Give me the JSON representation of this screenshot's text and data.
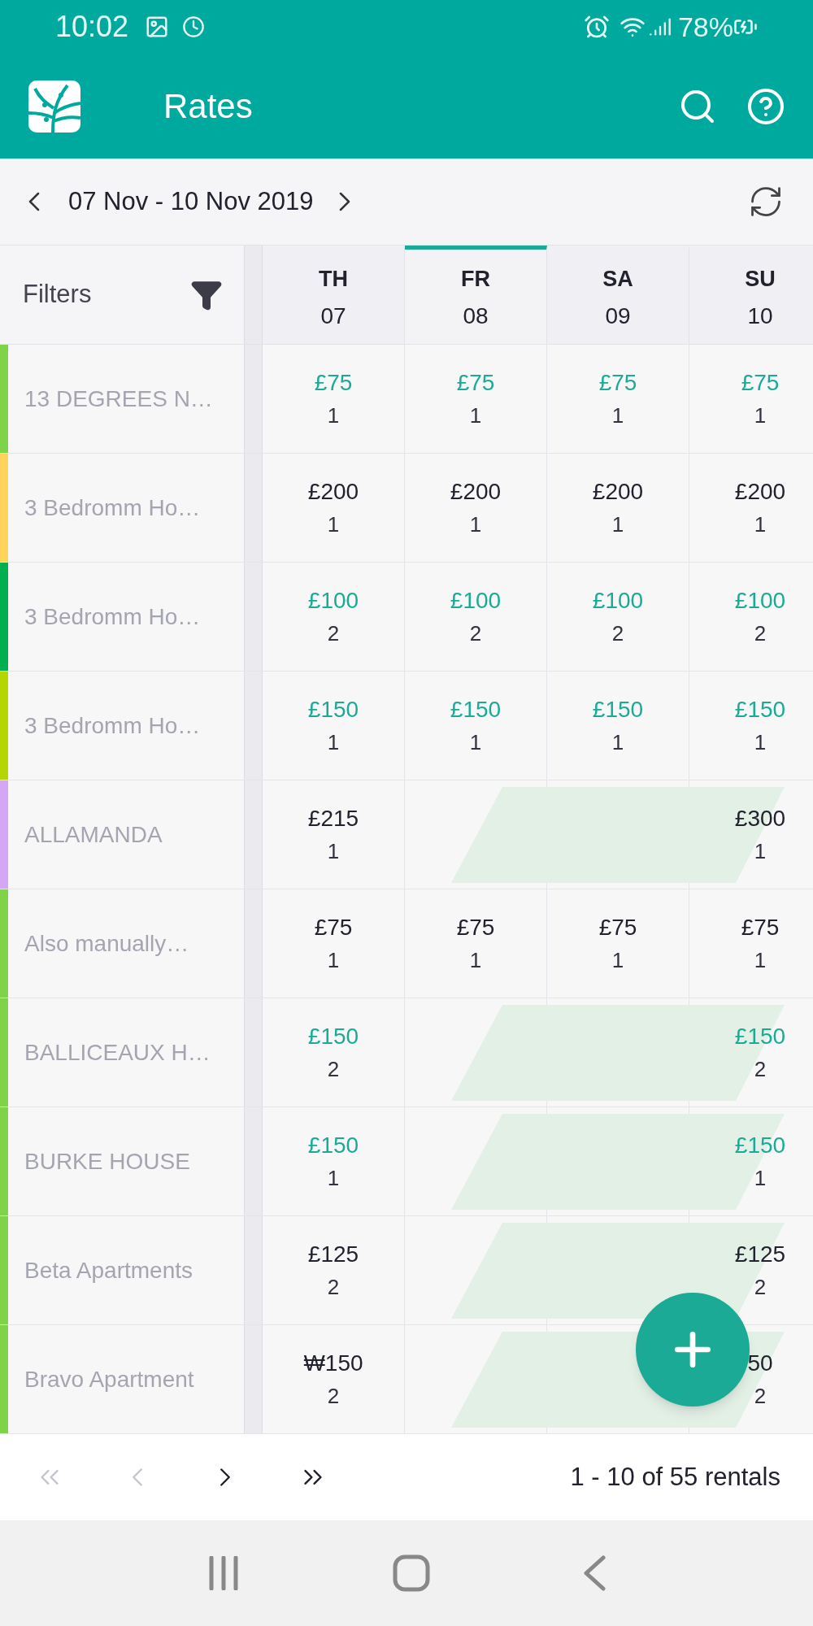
{
  "status_bar": {
    "time": "10:02",
    "battery": "78%"
  },
  "app_bar": {
    "title": "Rates"
  },
  "date_range": {
    "label": "07 Nov - 10 Nov 2019"
  },
  "filters": {
    "label": "Filters"
  },
  "days": [
    {
      "weekday": "TH",
      "date": "07",
      "selected": false
    },
    {
      "weekday": "FR",
      "date": "08",
      "selected": true
    },
    {
      "weekday": "SA",
      "date": "09",
      "selected": false
    },
    {
      "weekday": "SU",
      "date": "10",
      "selected": false
    }
  ],
  "rentals": [
    {
      "name": "13 DEGREES N…",
      "color": "#7ed348",
      "booked": false,
      "cells": [
        {
          "kind": "rate",
          "price": "£75",
          "count": "1",
          "highlighted": true
        },
        {
          "kind": "rate",
          "price": "£75",
          "count": "1",
          "highlighted": true
        },
        {
          "kind": "rate",
          "price": "£75",
          "count": "1",
          "highlighted": true
        },
        {
          "kind": "rate",
          "price": "£75",
          "count": "1",
          "highlighted": true
        }
      ]
    },
    {
      "name": "3 Bedromm Ho…",
      "color": "#ffd45c",
      "booked": false,
      "cells": [
        {
          "kind": "rate",
          "price": "£200",
          "count": "1",
          "highlighted": false
        },
        {
          "kind": "rate",
          "price": "£200",
          "count": "1",
          "highlighted": false
        },
        {
          "kind": "rate",
          "price": "£200",
          "count": "1",
          "highlighted": false
        },
        {
          "kind": "rate",
          "price": "£200",
          "count": "1",
          "highlighted": false
        }
      ]
    },
    {
      "name": "3 Bedromm Ho…",
      "color": "#00b050",
      "booked": false,
      "cells": [
        {
          "kind": "rate",
          "price": "£100",
          "count": "2",
          "highlighted": true
        },
        {
          "kind": "rate",
          "price": "£100",
          "count": "2",
          "highlighted": true
        },
        {
          "kind": "rate",
          "price": "£100",
          "count": "2",
          "highlighted": true
        },
        {
          "kind": "rate",
          "price": "£100",
          "count": "2",
          "highlighted": true
        }
      ]
    },
    {
      "name": "3 Bedromm Ho…",
      "color": "#b5d600",
      "booked": false,
      "cells": [
        {
          "kind": "rate",
          "price": "£150",
          "count": "1",
          "highlighted": true
        },
        {
          "kind": "rate",
          "price": "£150",
          "count": "1",
          "highlighted": true
        },
        {
          "kind": "rate",
          "price": "£150",
          "count": "1",
          "highlighted": true
        },
        {
          "kind": "rate",
          "price": "£150",
          "count": "1",
          "highlighted": true
        }
      ]
    },
    {
      "name": "ALLAMANDA",
      "color": "#d5a6f5",
      "booked": true,
      "cells": [
        {
          "kind": "rate",
          "price": "£215",
          "count": "1",
          "highlighted": false
        },
        {
          "kind": "empty"
        },
        {
          "kind": "empty"
        },
        {
          "kind": "rate",
          "price": "£300",
          "count": "1",
          "highlighted": false
        }
      ]
    },
    {
      "name": "Also manually…",
      "color": "#7ed348",
      "booked": false,
      "cells": [
        {
          "kind": "rate",
          "price": "£75",
          "count": "1",
          "highlighted": false
        },
        {
          "kind": "rate",
          "price": "£75",
          "count": "1",
          "highlighted": false
        },
        {
          "kind": "rate",
          "price": "£75",
          "count": "1",
          "highlighted": false
        },
        {
          "kind": "rate",
          "price": "£75",
          "count": "1",
          "highlighted": false
        }
      ]
    },
    {
      "name": "BALLICEAUX H…",
      "color": "#7ed348",
      "booked": true,
      "cells": [
        {
          "kind": "rate",
          "price": "£150",
          "count": "2",
          "highlighted": true
        },
        {
          "kind": "empty"
        },
        {
          "kind": "empty"
        },
        {
          "kind": "rate",
          "price": "£150",
          "count": "2",
          "highlighted": true
        }
      ]
    },
    {
      "name": "BURKE HOUSE",
      "color": "#7ed348",
      "booked": true,
      "cells": [
        {
          "kind": "rate",
          "price": "£150",
          "count": "1",
          "highlighted": true
        },
        {
          "kind": "empty"
        },
        {
          "kind": "empty"
        },
        {
          "kind": "rate",
          "price": "£150",
          "count": "1",
          "highlighted": true
        }
      ]
    },
    {
      "name": "Beta Apartments",
      "color": "#7ed348",
      "booked": true,
      "cells": [
        {
          "kind": "rate",
          "price": "£125",
          "count": "2",
          "highlighted": false
        },
        {
          "kind": "empty"
        },
        {
          "kind": "empty"
        },
        {
          "kind": "rate",
          "price": "£125",
          "count": "2",
          "highlighted": false
        }
      ]
    },
    {
      "name": "Bravo Apartment",
      "color": "#7ed348",
      "booked": true,
      "cells": [
        {
          "kind": "rate",
          "price": "₩150",
          "count": "2",
          "highlighted": false
        },
        {
          "kind": "empty"
        },
        {
          "kind": "empty"
        },
        {
          "kind": "rate",
          "price": "50",
          "count": "2",
          "highlighted": false
        }
      ]
    }
  ],
  "pager": {
    "buttons": [
      {
        "kind": "first",
        "disabled": true
      },
      {
        "kind": "previous",
        "disabled": true
      },
      {
        "kind": "next",
        "disabled": false
      },
      {
        "kind": "last",
        "disabled": false
      }
    ],
    "summary": "1 - 10 of 55 rentals"
  }
}
